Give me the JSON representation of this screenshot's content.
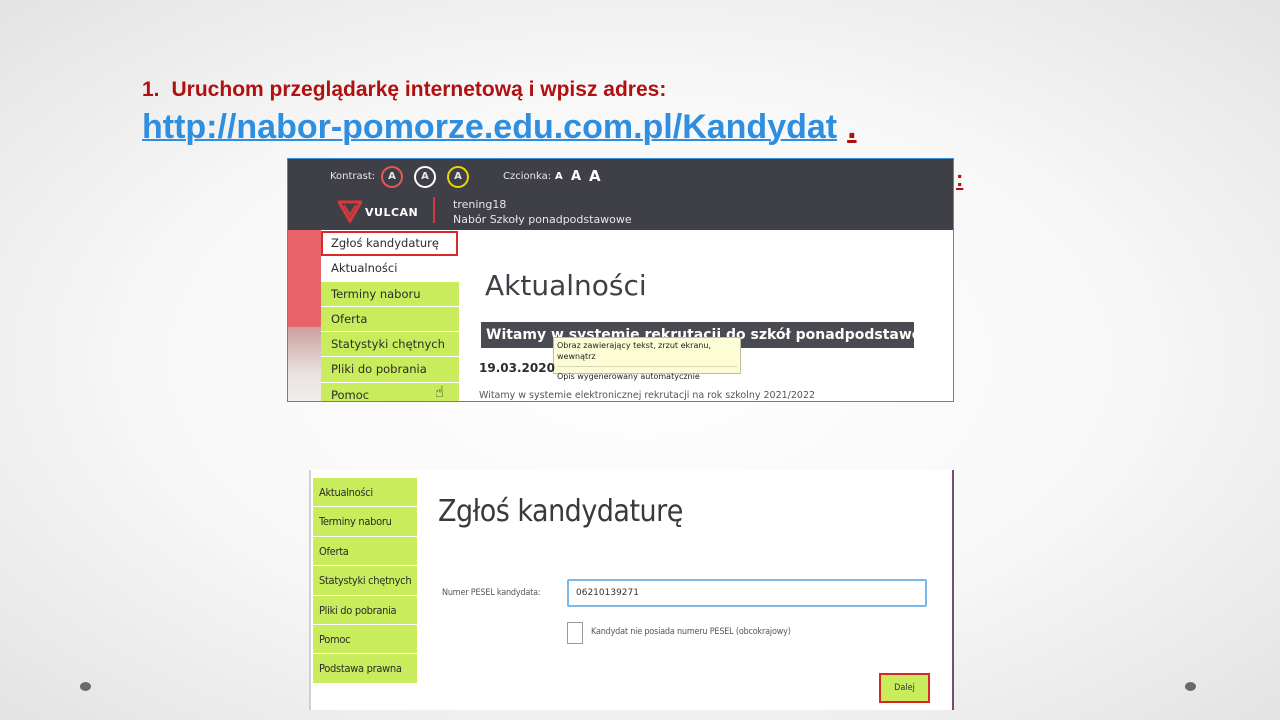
{
  "instruction": {
    "number": "1.",
    "text": "Uruchom przeglądarkę internetową i wpisz adres:",
    "url": "http://nabor-pomorze.edu.com.pl/Kandydat",
    "trailing_dot": ".",
    "stray_colon": ":"
  },
  "screenshot1": {
    "kontrast_label": "Kontrast:",
    "contrast_options": [
      "A",
      "A",
      "A"
    ],
    "czcionka_label": "Czcionka:",
    "font_sizes": [
      "A",
      "A",
      "A"
    ],
    "logo_text": "VULCAN",
    "tenant_name": "trening18",
    "tenant_subtitle": "Nabór Szkoły ponadpodstawowe",
    "menu": [
      "Zgłoś kandydaturę",
      "Aktualności",
      "Terminy naboru",
      "Oferta",
      "Statystyki chętnych",
      "Pliki do pobrania",
      "Pomoc"
    ],
    "title": "Aktualności",
    "banner": "Witamy w systemie rekrutacji do szkół ponadpodstawowych",
    "tooltip_line1": "Obraz zawierający tekst, zrzut ekranu, wewnątrz",
    "tooltip_line2": "Opis wygenerowany automatycznie",
    "date": "19.03.2020",
    "welcome": "Witamy w systemie elektronicznej rekrutacji na rok szkolny 2021/2022"
  },
  "screenshot2": {
    "menu": [
      "Aktualności",
      "Terminy naboru",
      "Oferta",
      "Statystyki chętnych",
      "Pliki do pobrania",
      "Pomoc",
      "Podstawa prawna"
    ],
    "title": "Zgłoś kandydaturę",
    "pesel_label": "Numer PESEL kandydata:",
    "pesel_value": "06210139271",
    "checkbox_label": "Kandydat nie posiada numeru PESEL (obcokrajowy)",
    "next_button": "Dalej"
  },
  "colors": {
    "heading_red": "#b01010",
    "link_blue": "#2e8ee0",
    "menu_green": "#c8ec5c",
    "header_dark": "#3f3f47",
    "highlight_red": "#d92828"
  }
}
